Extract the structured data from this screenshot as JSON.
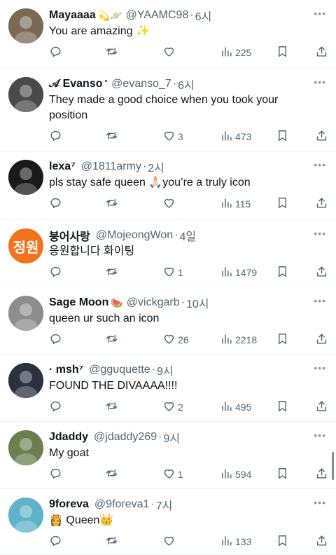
{
  "replies": [
    {
      "name": "Mayaaaa",
      "badge": "💫🪐",
      "handle": "@YAAMC98",
      "time": "6시",
      "text": "You are amazing ✨",
      "likes": "",
      "views": "225",
      "avatar_color": "#7a6a55",
      "avatar_icon": "cat-photo-avatar"
    },
    {
      "name": "𝒜 Evanso",
      "badge": "˚",
      "handle": "@evanso_7",
      "time": "6시",
      "text": "They made a good choice when you took your position",
      "likes": "3",
      "views": "473",
      "avatar_color": "#4a4a4a",
      "avatar_icon": "person-photo-avatar"
    },
    {
      "name": "lexa⁷",
      "badge": "",
      "handle": "@1811army",
      "time": "2시",
      "text": "pls stay safe queen 🙏🏻you’re a truly  icon",
      "likes": "",
      "views": "115",
      "avatar_color": "#1a1a1a",
      "avatar_icon": "person-photo-avatar"
    },
    {
      "name": "붕어사랑",
      "badge": "",
      "handle": "@MojeongWon",
      "time": "4일",
      "text": "응원합니다 화이팅",
      "likes": "1",
      "views": "1479",
      "avatar_color": "#f2731d",
      "avatar_text": "정원"
    },
    {
      "name": "Sage Moon",
      "badge": "🍉",
      "handle": "@vickgarb",
      "time": "10시",
      "text": "queen ur such an icon",
      "likes": "26",
      "views": "2218",
      "avatar_color": "#8d8d8d",
      "avatar_icon": "person-photo-avatar"
    },
    {
      "name": "· msh⁷",
      "badge": "",
      "handle": "@gguquette",
      "time": "9시",
      "text": "FOUND THE DIVAAAA!!!!",
      "likes": "2",
      "views": "495",
      "avatar_color": "#2c3140",
      "avatar_icon": "person-photo-avatar"
    },
    {
      "name": "Jdaddy",
      "badge": "",
      "handle": "@jdaddy269",
      "time": "9시",
      "text": "My goat",
      "likes": "1",
      "views": "594",
      "avatar_color": "#6b7f4e",
      "avatar_icon": "group-photo-avatar"
    },
    {
      "name": "9foreva",
      "badge": "",
      "handle": "@9foreva1",
      "time": "7시",
      "text": "👸 Queen👑",
      "likes": "",
      "views": "133",
      "avatar_color": "#5fb3c9",
      "avatar_icon": "person-photo-avatar"
    }
  ],
  "icons": {
    "more": "more-icon",
    "reply": "reply-icon",
    "retweet": "retweet-icon",
    "like": "like-icon",
    "views": "views-icon",
    "bookmark": "bookmark-icon",
    "share": "share-icon"
  },
  "colors": {
    "text": "#0f1419",
    "secondary": "#536471",
    "divider": "#eff3f4"
  }
}
